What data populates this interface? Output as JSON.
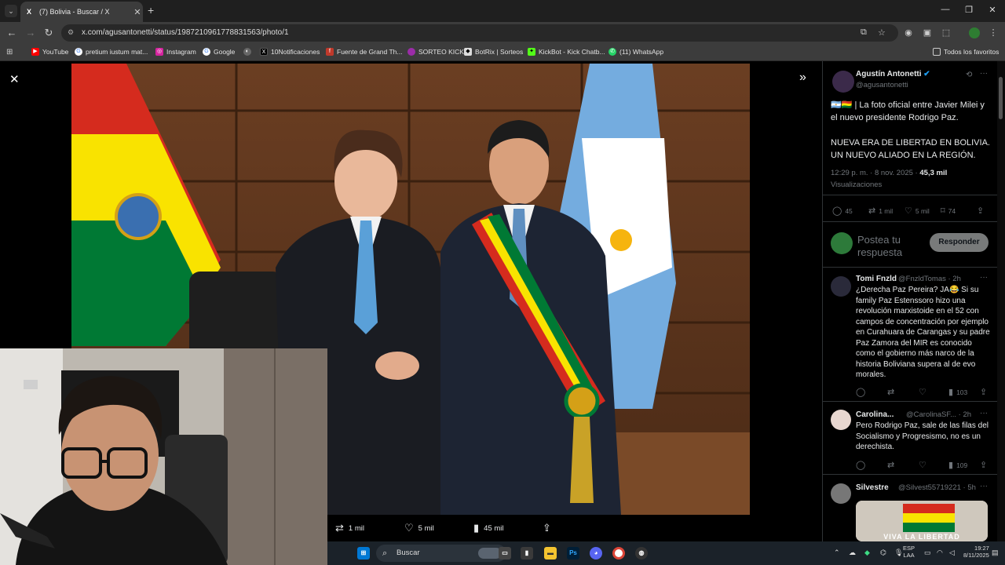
{
  "browser": {
    "tab_title": "(7) Bolivia - Buscar / X",
    "tab_favicon": "X",
    "url": "x.com/agusantonetti/status/1987210961778831563/photo/1",
    "bookmarks": [
      {
        "label": "YouTube",
        "color": "#ff0000",
        "icon": "youtube-icon"
      },
      {
        "label": "pretium iustum mat...",
        "color": "#4285f4",
        "icon": "google-icon"
      },
      {
        "label": "Instagram",
        "color": "#d6249f",
        "icon": "instagram-icon"
      },
      {
        "label": "Google",
        "color": "#4285f4",
        "icon": "google-icon"
      },
      {
        "label": "",
        "color": "#888888",
        "icon": "globe-icon"
      },
      {
        "label": "10Notificaciones",
        "color": "#000000",
        "icon": "x-icon"
      },
      {
        "label": "Fuente de Grand Th...",
        "color": "#c0392b",
        "icon": "font-icon"
      },
      {
        "label": "SORTEO KICK",
        "color": "#9b2ca8",
        "icon": "kick-icon"
      },
      {
        "label": "BotRix | Sorteos",
        "color": "#dddddd",
        "icon": "diamond-icon"
      },
      {
        "label": "KickBot - Kick Chatb...",
        "color": "#53fc18",
        "icon": "kickbot-icon"
      },
      {
        "label": "(11) WhatsApp",
        "color": "#25d366",
        "icon": "whatsapp-icon"
      }
    ],
    "all_bookmarks": "Todos los favoritos"
  },
  "viewer": {
    "actions": {
      "retweets": "1 mil",
      "likes": "5 mil",
      "views": "45 mil"
    }
  },
  "post": {
    "author": "Agustín Antonetti",
    "handle": "@agusantonetti",
    "text1": "🇦🇷🇧🇴 | La foto oficial entre Javier Milei y el nuevo presidente Rodrigo Paz.",
    "text2": "NUEVA ERA DE LIBERTAD EN BOLIVIA. UN NUEVO ALIADO EN LA REGIÓN.",
    "time": "12:29 p. m. · 8 nov. 2025 ·",
    "views_count": "45,3 mil",
    "views_label": "Visualizaciones",
    "stats": {
      "replies": "45",
      "retweets": "1 mil",
      "likes": "5 mil",
      "bookmarks": "74"
    },
    "reply_placeholder": "Postea tu respuesta",
    "reply_button": "Responder"
  },
  "replies": [
    {
      "name": "Tomi Fnzld",
      "handle": "@FnzldTomas · 2h",
      "text": "¿Derecha Paz Pereira? JA😂 Si su family Paz Estenssoro hizo una revolución marxistoide en el 52 con campos de concentración por ejemplo en Curahuara de Carangas y su padre Paz Zamora del MIR es conocido como el gobierno más narco de la historia Boliviana supera al de evo morales.",
      "views": "103"
    },
    {
      "name": "Carolina...",
      "handle": "@CarolinaSF... · 2h",
      "text": "Pero Rodrigo Paz, sale de las filas del Socialismo y Progresismo, no es un derechista.",
      "views": "109"
    },
    {
      "name": "Silvestre",
      "handle": "@Silvest55719221 · 5h",
      "image_caption": "VIVA LA LIBERTAD"
    }
  ],
  "taskbar": {
    "search": "Buscar",
    "lang": "ESP",
    "lang2": "LAA",
    "time": "19:27",
    "date": "8/11/2025"
  }
}
